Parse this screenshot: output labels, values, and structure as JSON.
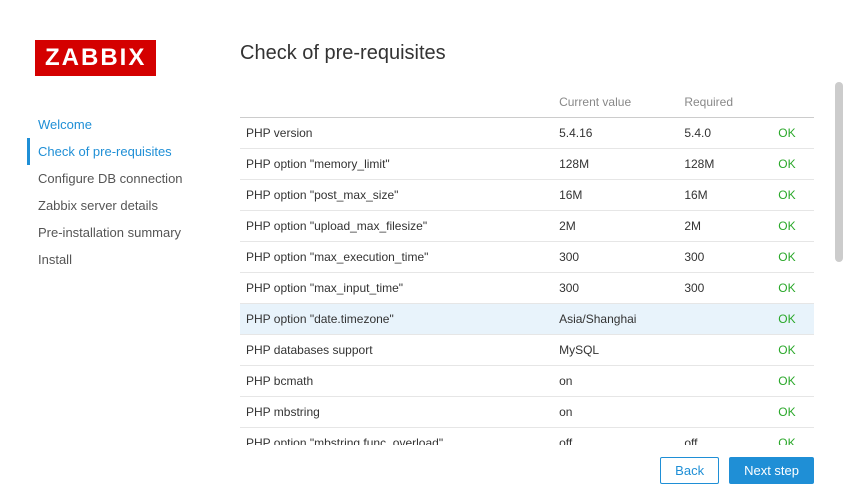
{
  "logo": "ZABBIX",
  "nav": [
    {
      "label": "Welcome",
      "state": "done"
    },
    {
      "label": "Check of pre-requisites",
      "state": "active"
    },
    {
      "label": "Configure DB connection",
      "state": ""
    },
    {
      "label": "Zabbix server details",
      "state": ""
    },
    {
      "label": "Pre-installation summary",
      "state": ""
    },
    {
      "label": "Install",
      "state": ""
    }
  ],
  "title": "Check of pre-requisites",
  "table": {
    "headers": {
      "name": "",
      "current": "Current value",
      "required": "Required",
      "status": ""
    },
    "rows": [
      {
        "name": "PHP version",
        "current": "5.4.16",
        "required": "5.4.0",
        "status": "OK",
        "hl": false
      },
      {
        "name": "PHP option \"memory_limit\"",
        "current": "128M",
        "required": "128M",
        "status": "OK",
        "hl": false
      },
      {
        "name": "PHP option \"post_max_size\"",
        "current": "16M",
        "required": "16M",
        "status": "OK",
        "hl": false
      },
      {
        "name": "PHP option \"upload_max_filesize\"",
        "current": "2M",
        "required": "2M",
        "status": "OK",
        "hl": false
      },
      {
        "name": "PHP option \"max_execution_time\"",
        "current": "300",
        "required": "300",
        "status": "OK",
        "hl": false
      },
      {
        "name": "PHP option \"max_input_time\"",
        "current": "300",
        "required": "300",
        "status": "OK",
        "hl": false
      },
      {
        "name": "PHP option \"date.timezone\"",
        "current": "Asia/Shanghai",
        "required": "",
        "status": "OK",
        "hl": true
      },
      {
        "name": "PHP databases support",
        "current": "MySQL",
        "required": "",
        "status": "OK",
        "hl": false
      },
      {
        "name": "PHP bcmath",
        "current": "on",
        "required": "",
        "status": "OK",
        "hl": false
      },
      {
        "name": "PHP mbstring",
        "current": "on",
        "required": "",
        "status": "OK",
        "hl": false
      },
      {
        "name": "PHP option \"mbstring.func_overload\"",
        "current": "off",
        "required": "off",
        "status": "OK",
        "hl": false
      }
    ]
  },
  "buttons": {
    "back": "Back",
    "next": "Next step"
  }
}
